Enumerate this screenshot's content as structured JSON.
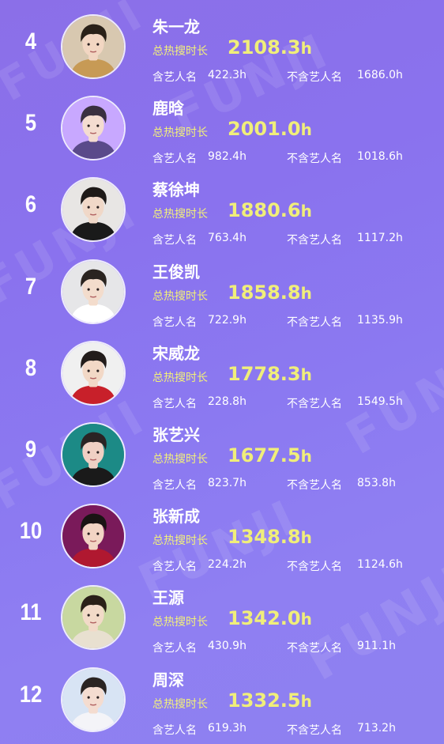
{
  "labels": {
    "hot_total": "总热搜时长",
    "with_name": "含艺人名",
    "without_name": "不含艺人名",
    "unit": "h"
  },
  "watermark": "FUNJI",
  "entries": [
    {
      "rank": "4",
      "name": "朱一龙",
      "total": "2108.3",
      "with": "422.3h",
      "without": "1686.0h",
      "avatar_bg": "#d8c8b0",
      "hair": "#2a2118",
      "skin": "#f2d6c2",
      "shirt": "#c79a55"
    },
    {
      "rank": "5",
      "name": "鹿晗",
      "total": "2001.0",
      "with": "982.4h",
      "without": "1018.6h",
      "avatar_bg": "#c8a8ff",
      "hair": "#3a3040",
      "skin": "#f4dcd0",
      "shirt": "#5a4a8a"
    },
    {
      "rank": "6",
      "name": "蔡徐坤",
      "total": "1880.6",
      "with": "763.4h",
      "without": "1117.2h",
      "avatar_bg": "#e8e6e4",
      "hair": "#1e1a18",
      "skin": "#f0d8c8",
      "shirt": "#1a1a1a"
    },
    {
      "rank": "7",
      "name": "王俊凯",
      "total": "1858.8",
      "with": "722.9h",
      "without": "1135.9h",
      "avatar_bg": "#e6e6e8",
      "hair": "#2a2420",
      "skin": "#f3dccc",
      "shirt": "#ffffff"
    },
    {
      "rank": "8",
      "name": "宋威龙",
      "total": "1778.3",
      "with": "228.8h",
      "without": "1549.5h",
      "avatar_bg": "#f0f0f0",
      "hair": "#221c1a",
      "skin": "#f2d8c6",
      "shirt": "#c8202a"
    },
    {
      "rank": "9",
      "name": "张艺兴",
      "total": "1677.5",
      "with": "823.7h",
      "without": "853.8h",
      "avatar_bg": "#1c8a86",
      "hair": "#2a2424",
      "skin": "#f0d0c4",
      "shirt": "#1a1a1a"
    },
    {
      "rank": "10",
      "name": "张新成",
      "total": "1348.8",
      "with": "224.2h",
      "without": "1124.6h",
      "avatar_bg": "#7a1a5a",
      "hair": "#1a1414",
      "skin": "#f2d4c4",
      "shirt": "#b01830"
    },
    {
      "rank": "11",
      "name": "王源",
      "total": "1342.0",
      "with": "430.9h",
      "without": "911.1h",
      "avatar_bg": "#c8d8a0",
      "hair": "#2a2018",
      "skin": "#f2dac8",
      "shirt": "#e8e0d0"
    },
    {
      "rank": "12",
      "name": "周深",
      "total": "1332.5",
      "with": "619.3h",
      "without": "713.2h",
      "avatar_bg": "#d8e4f4",
      "hair": "#2a2422",
      "skin": "#f4dcd0",
      "shirt": "#f4f4f8"
    }
  ]
}
